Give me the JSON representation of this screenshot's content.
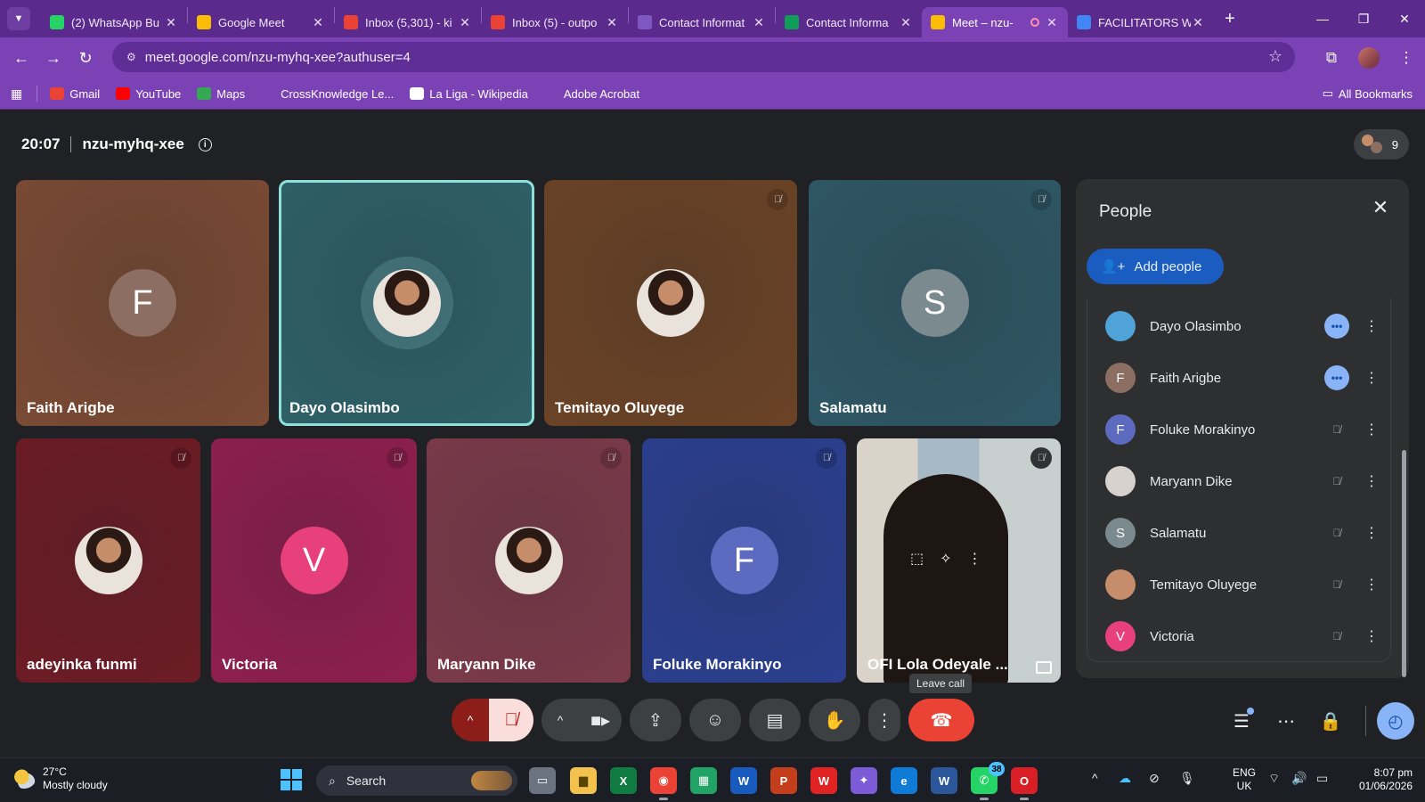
{
  "browser": {
    "tabs": [
      {
        "title": "(2) WhatsApp Bu",
        "favicon": "whatsapp-icon",
        "color": "#25d366"
      },
      {
        "title": "Google Meet",
        "favicon": "meet-icon",
        "color": "#fbbc04"
      },
      {
        "title": "Inbox (5,301) - ki",
        "favicon": "gmail-icon",
        "color": "#ea4335"
      },
      {
        "title": "Inbox (5) - outpo",
        "favicon": "gmail-icon",
        "color": "#ea4335"
      },
      {
        "title": "Contact Informat",
        "favicon": "forms-icon",
        "color": "#7e57c2"
      },
      {
        "title": "Contact Informa",
        "favicon": "sheets-icon",
        "color": "#0f9d58"
      },
      {
        "title": "Meet – nzu-",
        "favicon": "meet-icon",
        "color": "#fbbc04"
      },
      {
        "title": "FACILITATORS W",
        "favicon": "google-icon",
        "color": "#4285f4"
      }
    ],
    "url": "meet.google.com/nzu-myhq-xee?authuser=4",
    "bookmarks": [
      {
        "label": "Gmail",
        "icon": "gmail-icon",
        "color": "#ea4335"
      },
      {
        "label": "YouTube",
        "icon": "youtube-icon",
        "color": "#ff0000"
      },
      {
        "label": "Maps",
        "icon": "maps-icon",
        "color": "#34a853"
      },
      {
        "label": "CrossKnowledge Le...",
        "icon": "crossknowledge-icon",
        "color": "#7b42b5"
      },
      {
        "label": "La Liga - Wikipedia",
        "icon": "wikipedia-icon",
        "color": "#ffffff"
      },
      {
        "label": "Adobe Acrobat",
        "icon": "globe-icon",
        "color": "#7b42b5"
      }
    ],
    "all_bookmarks": "All Bookmarks"
  },
  "meeting": {
    "time": "20:07",
    "code": "nzu-myhq-xee",
    "participant_count": "9"
  },
  "tiles": [
    {
      "name": "Faith Arigbe",
      "initial": "F",
      "bg": "#7a4a34",
      "av_color": "#8d6e63",
      "muted": false,
      "speaking": false
    },
    {
      "name": "Dayo Olasimbo",
      "initial": "",
      "bg": "#2f6068",
      "av_color": "#4fa3d9",
      "muted": false,
      "speaking": true
    },
    {
      "name": "Temitayo Oluyege",
      "initial": "",
      "bg": "#6b4326",
      "av_color": "#c58d6a",
      "muted": true,
      "speaking": false
    },
    {
      "name": "Salamatu",
      "initial": "S",
      "bg": "#2f5765",
      "av_color": "#7b8a8f",
      "muted": true,
      "speaking": false
    },
    {
      "name": "adeyinka funmi",
      "initial": "",
      "bg": "#6d1c25",
      "av_color": "#b3323c",
      "muted": true,
      "speaking": false
    },
    {
      "name": "Victoria",
      "initial": "V",
      "bg": "#8e1f4f",
      "av_color": "#e8407a",
      "muted": true,
      "speaking": false
    },
    {
      "name": "Maryann Dike",
      "initial": "",
      "bg": "#7b3a4a",
      "av_color": "#d8d2cf",
      "muted": true,
      "speaking": false
    },
    {
      "name": "Foluke Morakinyo",
      "initial": "F",
      "bg": "#2b3f8f",
      "av_color": "#5c6bc0",
      "muted": true,
      "speaking": false
    },
    {
      "name": "OFI Lola Odeyale ...",
      "initial": "",
      "bg": "#444",
      "av_color": "#444",
      "muted": true,
      "speaking": false
    }
  ],
  "people_panel": {
    "title": "People",
    "add_label": "Add people",
    "people": [
      {
        "name": "Dayo Olasimbo",
        "initial": "",
        "color": "#4fa3d9",
        "status": "speaking"
      },
      {
        "name": "Faith Arigbe",
        "initial": "F",
        "color": "#8d6e63",
        "status": "speaking"
      },
      {
        "name": "Foluke Morakinyo",
        "initial": "F",
        "color": "#5c6bc0",
        "status": "muted"
      },
      {
        "name": "Maryann Dike",
        "initial": "",
        "color": "#d8d2cf",
        "status": "muted"
      },
      {
        "name": "Salamatu",
        "initial": "S",
        "color": "#7b8a8f",
        "status": "muted"
      },
      {
        "name": "Temitayo Oluyege",
        "initial": "",
        "color": "#c58d6a",
        "status": "muted"
      },
      {
        "name": "Victoria",
        "initial": "V",
        "color": "#e8407a",
        "status": "muted"
      }
    ]
  },
  "controls": {
    "leave_tooltip": "Leave call"
  },
  "taskbar": {
    "temperature": "27°C",
    "weather": "Mostly cloudy",
    "search_label": "Search",
    "whatsapp_badge": "38",
    "lang_line1": "ENG",
    "lang_line2": "UK",
    "clock_time": "8:07 pm",
    "clock_date": "01/06/2026"
  }
}
